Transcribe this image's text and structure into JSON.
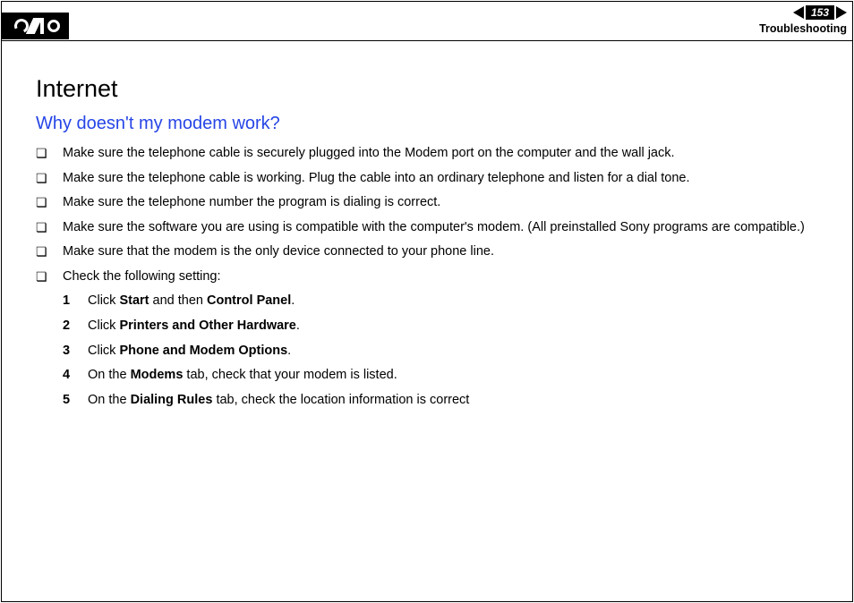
{
  "header": {
    "page_number": "153",
    "section": "Troubleshooting"
  },
  "content": {
    "heading": "Internet",
    "subheading": "Why doesn't my modem work?",
    "bullets": [
      "Make sure the telephone cable is securely plugged into the Modem port on the computer and the wall jack.",
      "Make sure the telephone cable is working. Plug the cable into an ordinary telephone and listen for a dial tone.",
      "Make sure the telephone number the program is dialing is correct.",
      "Make sure the software you are using is compatible with the computer's modem. (All preinstalled Sony programs are compatible.)",
      "Make sure that the modem is the only device connected to your phone line.",
      "Check the following setting:"
    ],
    "steps": [
      {
        "pre": "Click ",
        "b1": "Start",
        "mid": " and then ",
        "b2": "Control Panel",
        "post": "."
      },
      {
        "pre": "Click ",
        "b1": "Printers and Other Hardware",
        "mid": "",
        "b2": "",
        "post": "."
      },
      {
        "pre": "Click ",
        "b1": "Phone and Modem Options",
        "mid": "",
        "b2": "",
        "post": "."
      },
      {
        "pre": "On the ",
        "b1": "Modems",
        "mid": " tab, check that your modem is listed.",
        "b2": "",
        "post": ""
      },
      {
        "pre": "On the ",
        "b1": "Dialing Rules",
        "mid": " tab, check the location information is correct",
        "b2": "",
        "post": ""
      }
    ]
  }
}
